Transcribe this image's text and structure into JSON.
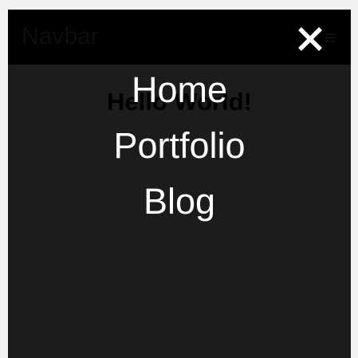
{
  "navbar": {
    "brand": "Navbar",
    "menu_icon": "hamburger-icon",
    "menu_glyph": "≡"
  },
  "page": {
    "heading": "Hello World!"
  },
  "overlay": {
    "close_icon": "close-icon",
    "items": [
      {
        "label": "Home"
      },
      {
        "label": "Portfolio"
      },
      {
        "label": "Blog"
      }
    ]
  },
  "colors": {
    "page_bg": "#f2f2f2",
    "panel_bg": "#1c1c1c",
    "navbar_bg": "#000000",
    "overlay_text": "#ffffff"
  }
}
